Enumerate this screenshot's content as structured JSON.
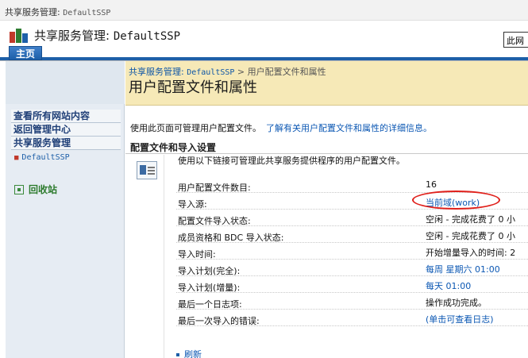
{
  "window": {
    "title_prefix": "共享服务管理: ",
    "title_ssp": "DefaultSSP"
  },
  "header": {
    "title_prefix": "共享服务管理: ",
    "title_ssp": "DefaultSSP",
    "this_site_label": "此网"
  },
  "topnav": {
    "home_tab": "主页"
  },
  "breadcrumb": {
    "root": "共享服务管理: ",
    "root_ssp": "DefaultSSP",
    "separator": ">",
    "current": "用户配置文件和属性"
  },
  "page": {
    "title": "用户配置文件和属性",
    "intro": "使用此页面可管理用户配置文件。",
    "intro_link": "了解有关用户配置文件和属性的详细信息。",
    "section_title": "配置文件和导入设置",
    "section_desc": "使用以下链接可管理此共享服务提供程序的用户配置文件。"
  },
  "quicklaunch": {
    "items": [
      {
        "label": "查看所有网站内容"
      },
      {
        "label": "返回管理中心"
      },
      {
        "label": "共享服务管理"
      }
    ],
    "sub_item": "DefaultSSP",
    "recycle": "回收站"
  },
  "properties": [
    {
      "label": "用户配置文件数目:",
      "value": "16",
      "link": false
    },
    {
      "label": "导入源:",
      "value": "当前域(work)",
      "link": true
    },
    {
      "label": "配置文件导入状态:",
      "value": "空闲 - 完成花费了 0 小",
      "link": false
    },
    {
      "label": "成员资格和 BDC 导入状态:",
      "value": "空闲 - 完成花费了 0 小",
      "link": false
    },
    {
      "label": "导入时间:",
      "value": "开始增量导入的时间: 2",
      "link": false
    },
    {
      "label": "导入计划(完全):",
      "value": "每周 星期六 01:00",
      "link": true
    },
    {
      "label": "导入计划(增量):",
      "value": "每天 01:00",
      "link": true
    },
    {
      "label": "最后一个日志项:",
      "value": "操作成功完成。",
      "link": false
    },
    {
      "label": "最后一次导入的错误:",
      "value": "(单击可查看日志)",
      "link": true
    }
  ],
  "actions": {
    "refresh": "刷新"
  },
  "colors": {
    "accent": "#1d5fa8",
    "header_band": "#f6e9b7",
    "link": "#0b57b3",
    "highlight": "#e0201b"
  }
}
